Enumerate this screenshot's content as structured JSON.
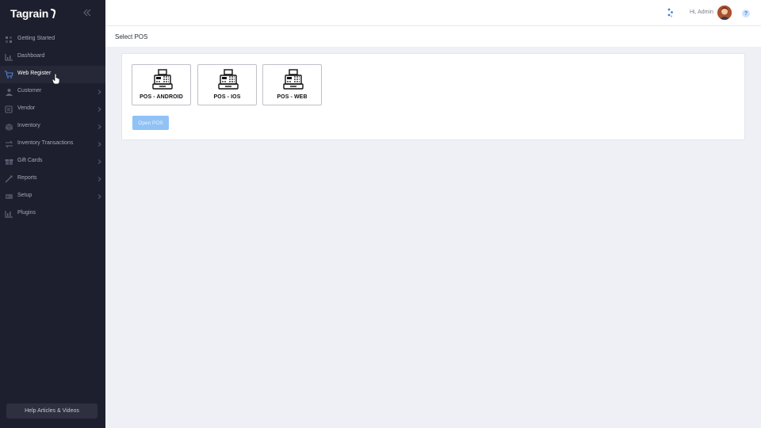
{
  "sidebar": {
    "brand": "Tagrain",
    "items": [
      {
        "label": "Getting Started",
        "icon": "flag-icon",
        "chevron": false
      },
      {
        "label": "Dashboard",
        "icon": "chart-icon",
        "chevron": false
      },
      {
        "label": "Web Register",
        "icon": "cart-icon",
        "chevron": false,
        "active": true
      },
      {
        "label": "Customer",
        "icon": "customer-icon",
        "chevron": true
      },
      {
        "label": "Vendor",
        "icon": "vendor-icon",
        "chevron": true
      },
      {
        "label": "Inventory",
        "icon": "box-icon",
        "chevron": true
      },
      {
        "label": "Inventory Transactions",
        "icon": "transactions-icon",
        "chevron": true
      },
      {
        "label": "Gift Cards",
        "icon": "gift-icon",
        "chevron": true
      },
      {
        "label": "Reports",
        "icon": "reports-icon",
        "chevron": true
      },
      {
        "label": "Setup",
        "icon": "setup-icon",
        "chevron": true
      },
      {
        "label": "Plugins",
        "icon": "plugins-icon",
        "chevron": false
      }
    ],
    "help_label": "Help Articles & Videos"
  },
  "header": {
    "greeting": "Hi, Admin",
    "help_glyph": "?"
  },
  "page": {
    "title": "Select POS"
  },
  "pos_options": [
    {
      "label": "POS - ANDROID"
    },
    {
      "label": "POS - IOS"
    },
    {
      "label": "POS - WEB"
    }
  ],
  "open_button_label": "Open POS",
  "colors": {
    "sidebar_bg": "#1e1f2e",
    "accent": "#90c2f5",
    "background": "#eef0f5"
  }
}
